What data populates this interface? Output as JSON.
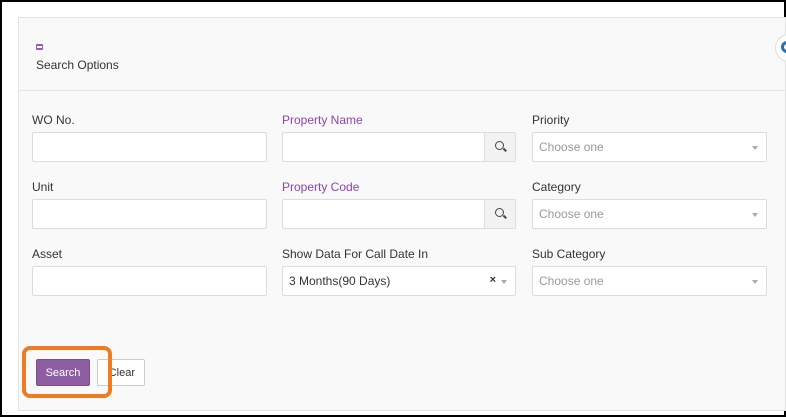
{
  "panel": {
    "title": "Search Options"
  },
  "fields": {
    "wo_no": {
      "label": "WO No.",
      "value": ""
    },
    "property_name": {
      "label": "Property Name",
      "value": ""
    },
    "priority": {
      "label": "Priority",
      "placeholder": "Choose one"
    },
    "unit": {
      "label": "Unit",
      "value": ""
    },
    "property_code": {
      "label": "Property Code",
      "value": ""
    },
    "category": {
      "label": "Category",
      "placeholder": "Choose one"
    },
    "asset": {
      "label": "Asset",
      "value": ""
    },
    "call_date": {
      "label": "Show Data For Call Date In",
      "value": "3 Months(90 Days)",
      "clear_symbol": "×"
    },
    "sub_category": {
      "label": "Sub Category",
      "placeholder": "Choose one"
    }
  },
  "buttons": {
    "search": "Search",
    "clear": "Clear"
  },
  "colors": {
    "accent": "#8e5ea2",
    "label_purple": "#8e44ad",
    "highlight": "#f07c22"
  },
  "icons": [
    "collapse-icon",
    "help-icon",
    "search-icon",
    "chevron-down-icon"
  ]
}
